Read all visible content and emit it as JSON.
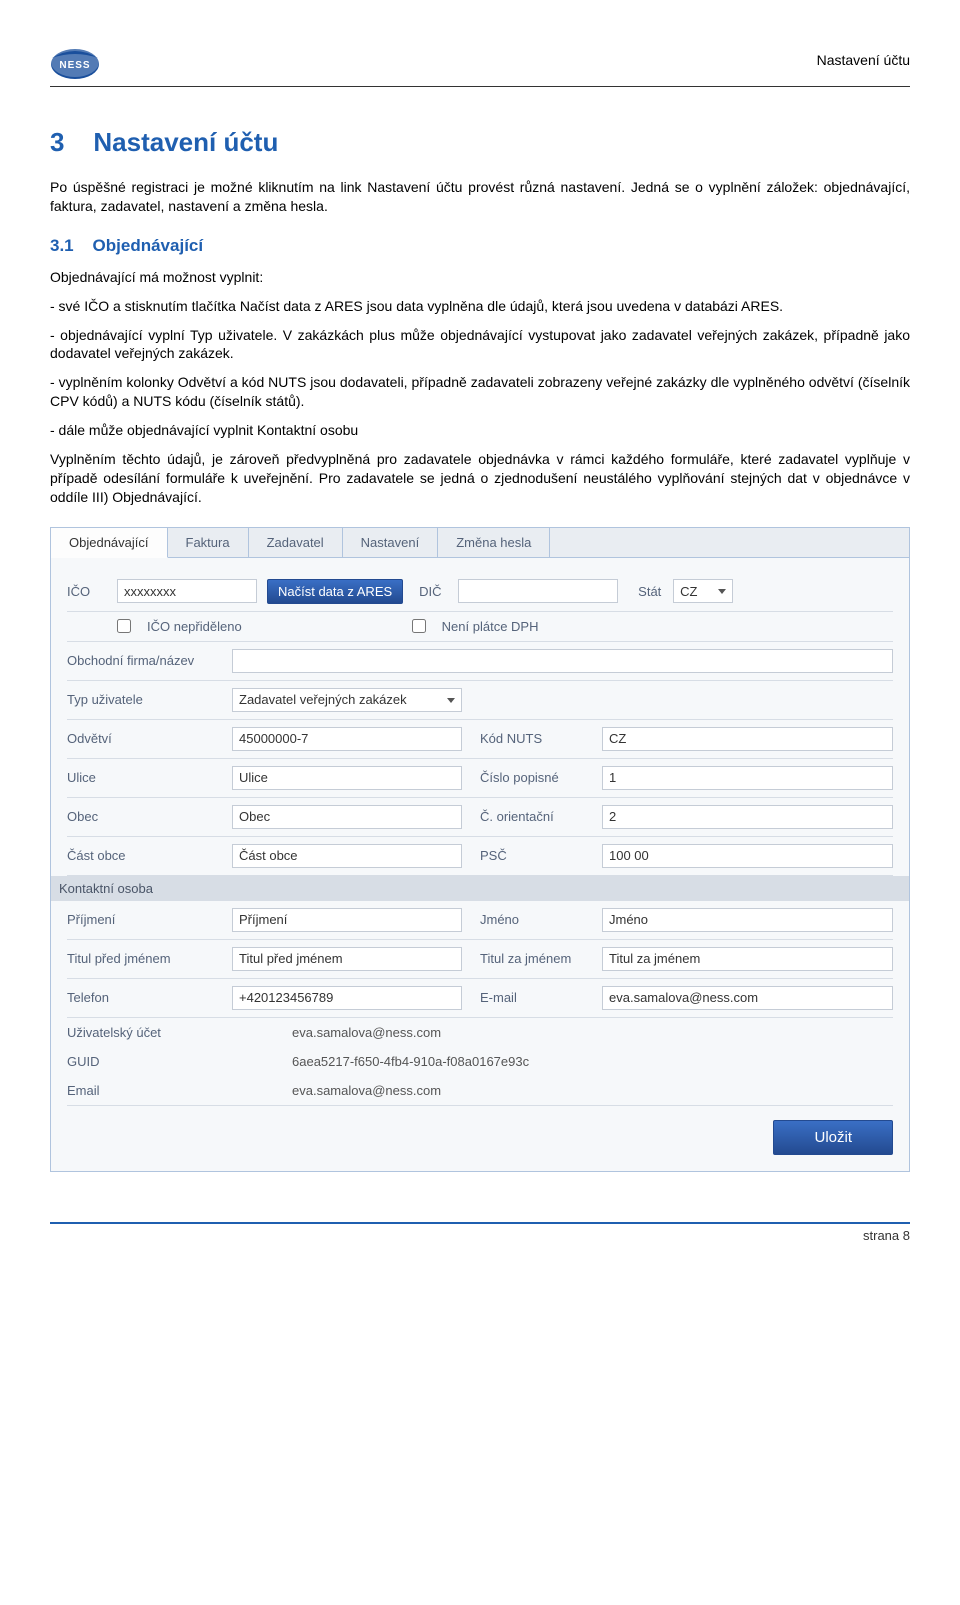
{
  "header": {
    "title_right": "Nastavení účtu",
    "logo_text": "NESS"
  },
  "section": {
    "num": "3",
    "title": "Nastavení účtu",
    "intro": "Po úspěšné registraci je možné kliknutím na link Nastavení účtu provést různá nastavení. Jedná se o vyplnění záložek: objednávající, faktura, zadavatel, nastavení a změna hesla.",
    "sub_num": "3.1",
    "sub_title": "Objednávající",
    "p1": "Objednávající má možnost vyplnit:",
    "p2": "- své IČO a stisknutím tlačítka Načíst data z ARES jsou data vyplněna dle údajů, která jsou uvedena v databázi ARES.",
    "p3": "- objednávající vyplní Typ uživatele. V zakázkách plus může objednávající vystupovat jako zadavatel veřejných zakázek, případně jako dodavatel veřejných zakázek.",
    "p4": "- vyplněním kolonky Odvětví a kód NUTS jsou dodavateli, případně zadavateli zobrazeny veřejné zakázky dle vyplněného odvětví (číselník CPV kódů) a NUTS kódu (číselník států).",
    "p5": "- dále může objednávající vyplnit Kontaktní osobu",
    "p6": "Vyplněním těchto údajů, je zároveň předvyplněná pro zadavatele objednávka v rámci každého formuláře, které zadavatel vyplňuje v případě odesílání formuláře k uveřejnění. Pro zadavatele se jedná o zjednodušení neustálého vyplňování stejných dat v objednávce v oddíle III) Objednávající."
  },
  "form": {
    "tabs": [
      "Objednávající",
      "Faktura",
      "Zadavatel",
      "Nastavení",
      "Změna hesla"
    ],
    "ico_label": "IČO",
    "ico_value": "xxxxxxxx",
    "ares_btn": "Načíst data z ARES",
    "dic_label": "DIČ",
    "stat_label": "Stát",
    "stat_value": "CZ",
    "ico_nepr": "IČO nepřiděleno",
    "neni_platce": "Není plátce DPH",
    "firma_label": "Obchodní firma/název",
    "typ_label": "Typ uživatele",
    "typ_value": "Zadavatel veřejných zakázek",
    "odvetvi_label": "Odvětví",
    "odvetvi_value": "45000000-7",
    "nuts_label": "Kód NUTS",
    "nuts_value": "CZ",
    "ulice_label": "Ulice",
    "ulice_value": "Ulice",
    "cp_label": "Číslo popisné",
    "cp_value": "1",
    "obec_label": "Obec",
    "obec_value": "Obec",
    "co_label": "Č. orientační",
    "co_value": "2",
    "cast_label": "Část obce",
    "cast_value": "Část obce",
    "psc_label": "PSČ",
    "psc_value": "100 00",
    "kontakt_header": "Kontaktní osoba",
    "prijmeni_label": "Příjmení",
    "prijmeni_value": "Příjmení",
    "jmeno_label": "Jméno",
    "jmeno_value": "Jméno",
    "titulp_label": "Titul před jménem",
    "titulp_value": "Titul před jménem",
    "titulz_label": "Titul za jménem",
    "titulz_value": "Titul za jménem",
    "tel_label": "Telefon",
    "tel_value": "+420123456789",
    "email_label": "E-mail",
    "email_value": "eva.samalova@ness.com",
    "ucet_label": "Uživatelský účet",
    "ucet_value": "eva.samalova@ness.com",
    "guid_label": "GUID",
    "guid_value": "6aea5217-f650-4fb4-910a-f08a0167e93c",
    "email2_label": "Email",
    "email2_value": "eva.samalova@ness.com",
    "save_btn": "Uložit"
  },
  "footer": {
    "text": "strana 8"
  }
}
